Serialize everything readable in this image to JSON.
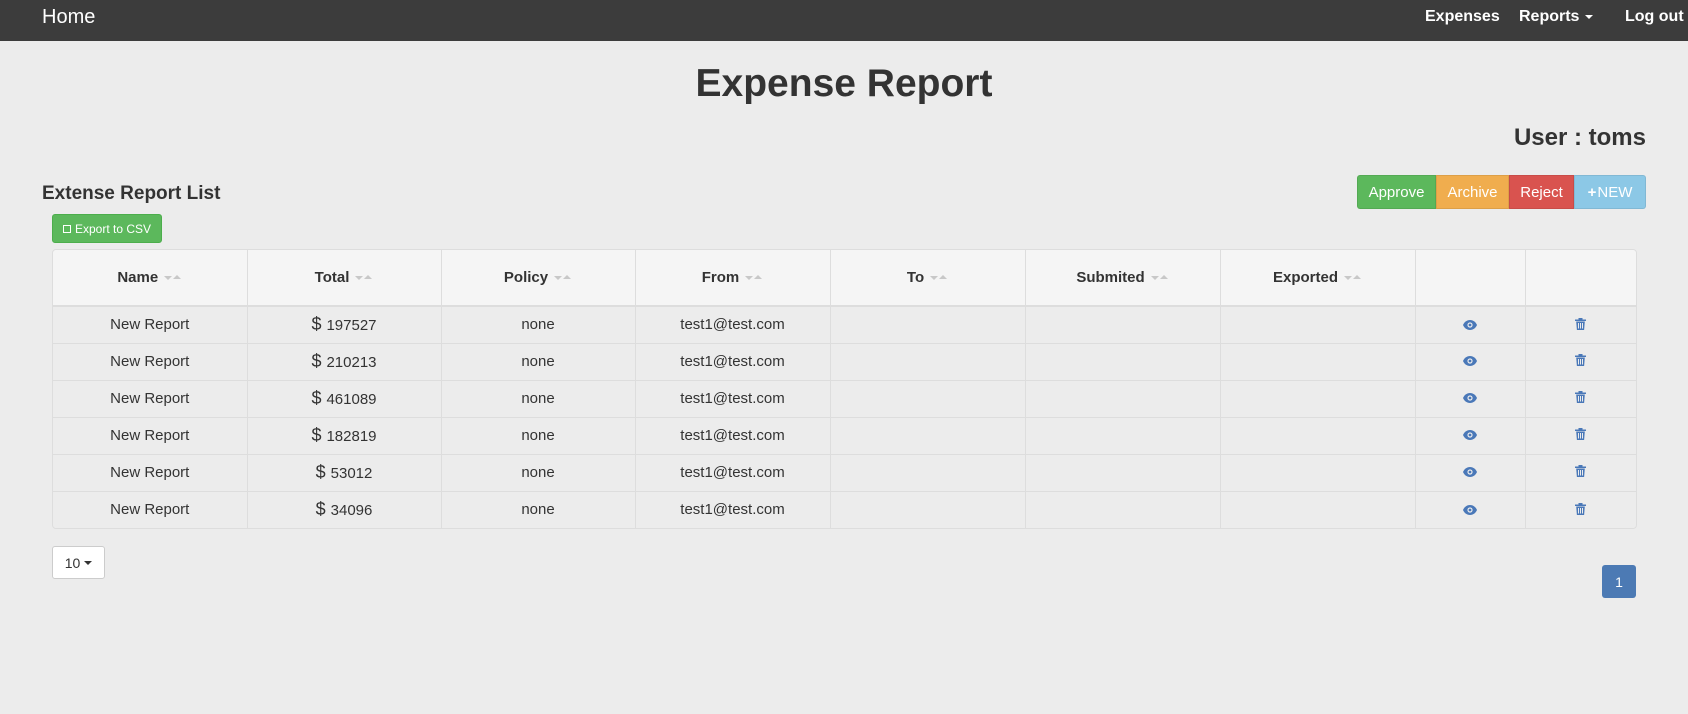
{
  "navbar": {
    "brand": "Home",
    "links": {
      "expenses": "Expenses",
      "reports": "Reports",
      "logout": "Log out"
    }
  },
  "header": {
    "title": "Expense Report",
    "user": "User : toms"
  },
  "list": {
    "title": "Extense Report List",
    "export_label": "Export to CSV"
  },
  "actions": {
    "approve": "Approve",
    "archive": "Archive",
    "reject": "Reject",
    "new_plus": "+",
    "new": "NEW"
  },
  "table": {
    "columns": [
      "Name",
      "Total",
      "Policy",
      "From",
      "To",
      "Submited",
      "Exported"
    ],
    "currency": "$",
    "rows": [
      {
        "name": "New Report",
        "total": "197527",
        "policy": "none",
        "from": "test1@test.com",
        "to": "",
        "submited": "",
        "exported": ""
      },
      {
        "name": "New Report",
        "total": "210213",
        "policy": "none",
        "from": "test1@test.com",
        "to": "",
        "submited": "",
        "exported": ""
      },
      {
        "name": "New Report",
        "total": "461089",
        "policy": "none",
        "from": "test1@test.com",
        "to": "",
        "submited": "",
        "exported": ""
      },
      {
        "name": "New Report",
        "total": "182819",
        "policy": "none",
        "from": "test1@test.com",
        "to": "",
        "submited": "",
        "exported": ""
      },
      {
        "name": "New Report",
        "total": "53012",
        "policy": "none",
        "from": "test1@test.com",
        "to": "",
        "submited": "",
        "exported": ""
      },
      {
        "name": "New Report",
        "total": "34096",
        "policy": "none",
        "from": "test1@test.com",
        "to": "",
        "submited": "",
        "exported": ""
      }
    ]
  },
  "pagination": {
    "page_size": "10",
    "current_page": "1"
  },
  "icons": {
    "view": "eye-icon",
    "delete": "trash-icon",
    "sort": "sort-icon"
  },
  "colors": {
    "navbar": "#3c3c3c",
    "approve": "#5cb85c",
    "archive": "#f0ad4e",
    "reject": "#d9534f",
    "new": "#8cc8e6",
    "page_active": "#4c7ab4",
    "icon": "#4a78b8"
  }
}
